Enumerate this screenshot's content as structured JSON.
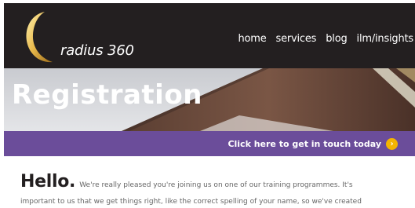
{
  "header": {
    "logo_text": "radius 360",
    "nav": [
      "home",
      "services",
      "blog",
      "ilm/insights"
    ]
  },
  "hero": {
    "title": "Registration"
  },
  "cta": {
    "label": "Click here to get in touch today",
    "icon": "chevron-right-circle-icon",
    "icon_color": "#f4b400"
  },
  "intro": {
    "greeting": "Hello.",
    "line1": "We're really pleased you're joining us on one of our training programmes. It's",
    "line2": "important to us that we get things right, like the correct spelling of your name, so we've created"
  },
  "colors": {
    "header_bg": "#231f20",
    "accent_purple": "#6b4d9a",
    "cta_icon": "#f4b400"
  }
}
